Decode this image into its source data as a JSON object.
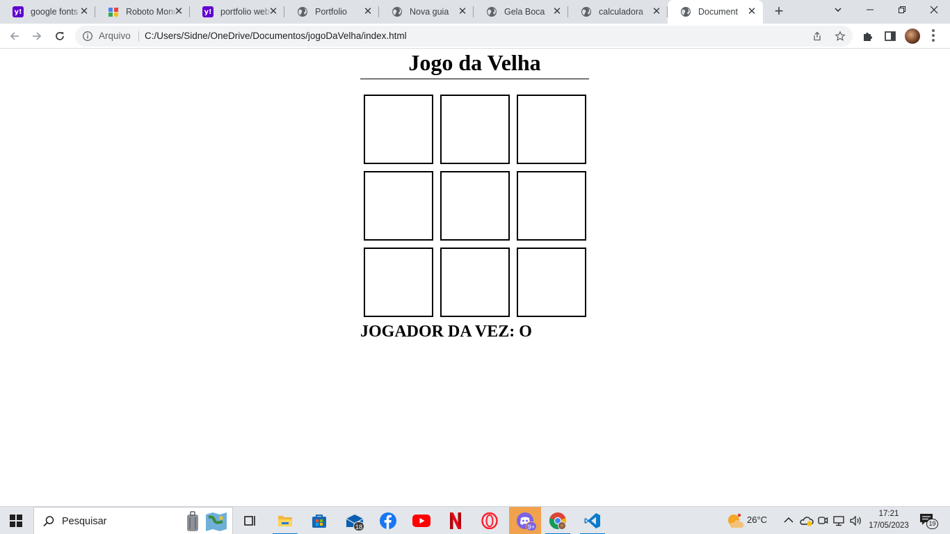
{
  "browser": {
    "tabs": [
      {
        "title": "google fonts",
        "favicon": "yahoo-icon",
        "active": false
      },
      {
        "title": "Roboto Mono",
        "favicon": "google-fonts-icon",
        "active": false
      },
      {
        "title": "portfolio web",
        "favicon": "yahoo-icon",
        "active": false
      },
      {
        "title": "Portfolio",
        "favicon": "globe-icon",
        "active": false
      },
      {
        "title": "Nova guia",
        "favicon": "globe-icon",
        "active": false
      },
      {
        "title": "Gela Boca",
        "favicon": "globe-icon",
        "active": false
      },
      {
        "title": "calculadora",
        "favicon": "globe-icon",
        "active": false
      },
      {
        "title": "Document",
        "favicon": "globe-icon",
        "active": true
      }
    ],
    "favicon_yahoo_text": "y!",
    "new_tab_label": "+",
    "close_label": "✕",
    "address": {
      "security_chip": "Arquivo",
      "url": "C:/Users/Sidne/OneDrive/Documentos/jogoDaVelha/index.html"
    }
  },
  "game": {
    "title": "Jogo da Velha",
    "cells": [
      "",
      "",
      "",
      "",
      "",
      "",
      "",
      "",
      ""
    ],
    "turn_label": "JOGADOR DA VEZ:",
    "current_player": "O"
  },
  "taskbar": {
    "search_label": "Pesquisar",
    "mail_badge": "18",
    "discord_badge": "9+",
    "weather": "26°C",
    "time": "17:21",
    "date": "17/05/2023",
    "notifications_badge": "19"
  },
  "colors": {
    "tabstrip": "#dee1e6",
    "omnibox": "#f1f3f4",
    "taskbar": "#e3e6ea",
    "accent": "#0078d4"
  }
}
